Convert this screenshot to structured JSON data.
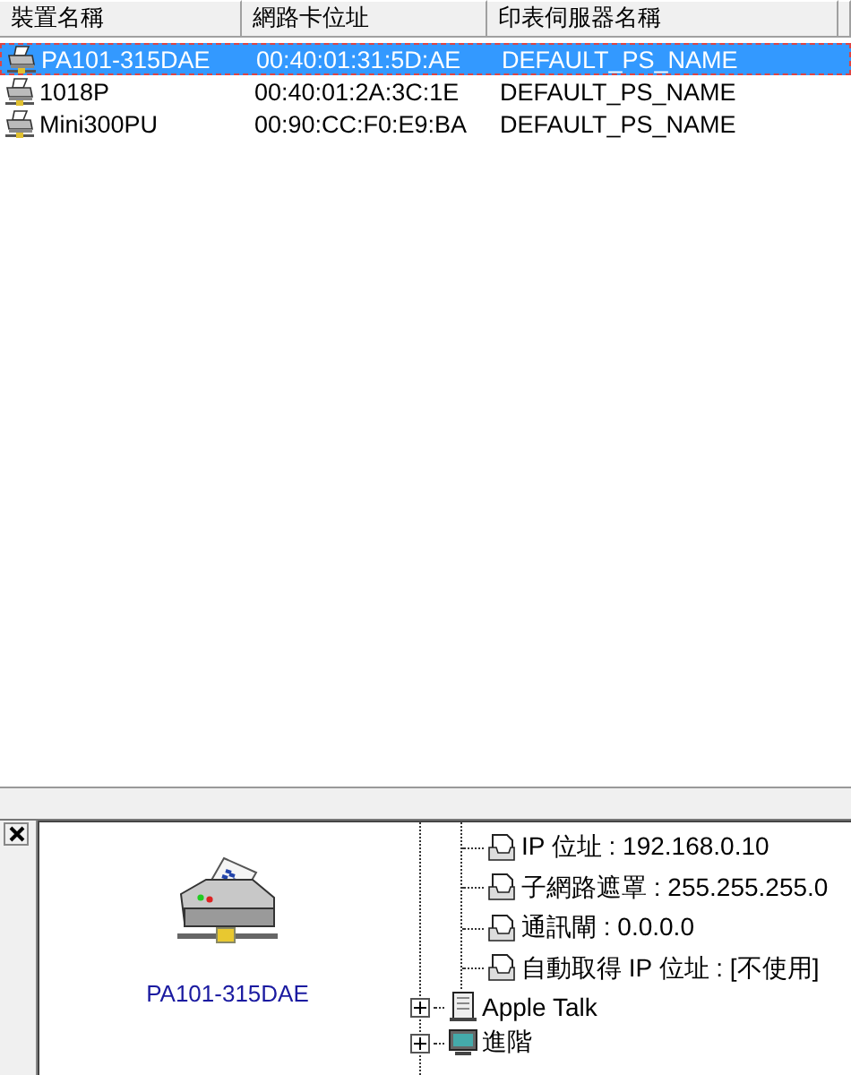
{
  "columns": [
    {
      "label": "裝置名稱"
    },
    {
      "label": "網路卡位址"
    },
    {
      "label": "印表伺服器名稱"
    }
  ],
  "devices": [
    {
      "name": "PA101-315DAE",
      "mac": "00:40:01:31:5D:AE",
      "server": "DEFAULT_PS_NAME",
      "selected": true
    },
    {
      "name": "1018P",
      "mac": "00:40:01:2A:3C:1E",
      "server": "DEFAULT_PS_NAME",
      "selected": false
    },
    {
      "name": "Mini300PU",
      "mac": "00:90:CC:F0:E9:BA",
      "server": "DEFAULT_PS_NAME",
      "selected": false
    }
  ],
  "detail": {
    "device_name": "PA101-315DAE"
  },
  "tree": [
    {
      "children": [
        {
          "label": "IP 位址 : 192.168.0.10"
        },
        {
          "label": "子網路遮罩 : 255.255.255.0"
        },
        {
          "label": "通訊閘 : 0.0.0.0"
        },
        {
          "label": "自動取得 IP 位址 : [不使用]"
        }
      ]
    },
    {
      "label": "Apple Talk",
      "kind": "book",
      "expanded": false
    },
    {
      "label": "進階",
      "kind": "monitor",
      "expanded": false
    }
  ]
}
